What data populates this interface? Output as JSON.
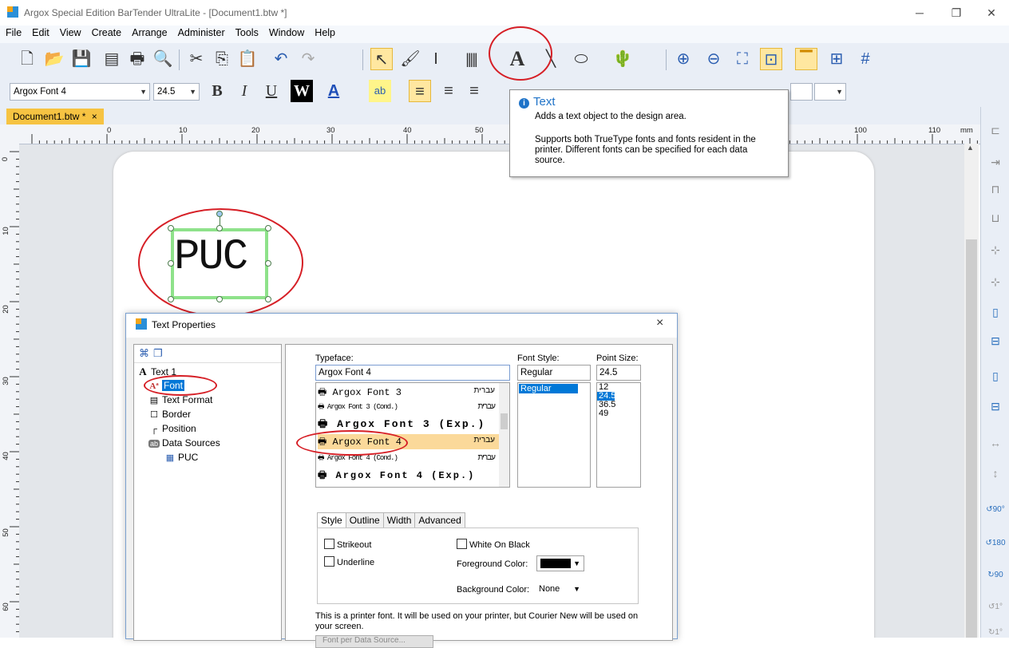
{
  "window": {
    "title": "Argox Special Edition BarTender UltraLite - [Document1.btw *]",
    "controls": {
      "minimize": "─",
      "restore": "❐",
      "close": "✕"
    }
  },
  "menubar": [
    "File",
    "Edit",
    "View",
    "Create",
    "Arrange",
    "Administer",
    "Tools",
    "Window",
    "Help"
  ],
  "format_toolbar": {
    "font_name": "Argox Font 4",
    "font_size": "24.5",
    "bold": "B",
    "italic": "I",
    "underline": "U",
    "white_on_black": "W",
    "font_color": "A",
    "highlight": "ab"
  },
  "document_tab": {
    "label": "Document1.btw *",
    "close": "×"
  },
  "ruler": {
    "unit": "mm",
    "h_marks": [
      "0",
      "10",
      "20",
      "30",
      "40",
      "50",
      "100",
      "110"
    ],
    "v_marks": [
      "0",
      "10",
      "20",
      "30",
      "40",
      "50",
      "60"
    ]
  },
  "label_object": {
    "text": "PUC"
  },
  "tooltip": {
    "title": "Text",
    "description": "Adds a text object to the design area.",
    "details": "Supports both TrueType fonts and fonts resident in the printer. Different fonts can be specified for each data source."
  },
  "dialog": {
    "title": "Text Properties",
    "close": "×",
    "tree": [
      {
        "label": "Text 1",
        "icon": "text-A-icon"
      },
      {
        "label": "Font",
        "icon": "font-icon",
        "selected": true
      },
      {
        "label": "Text Format",
        "icon": "text-format-icon"
      },
      {
        "label": "Border",
        "icon": "border-icon"
      },
      {
        "label": "Position",
        "icon": "position-icon"
      },
      {
        "label": "Data Sources",
        "icon": "data-sources-icon"
      },
      {
        "label": "PUC",
        "icon": "data-source-item-icon"
      }
    ],
    "font": {
      "typeface_label": "Typeface:",
      "typeface_value": "Argox Font 4",
      "style_label": "Font Style:",
      "style_value": "Regular",
      "size_label": "Point Size:",
      "size_value": "24.5",
      "typefaces": [
        {
          "name": "Argox Font 3",
          "script": "עברית"
        },
        {
          "name": "Argox Font 3 (Cond.)",
          "script": "עברית"
        },
        {
          "name": "Argox Font 3 (Exp.)",
          "script": ""
        },
        {
          "name": "Argox Font 4",
          "script": "עברית",
          "selected": true
        },
        {
          "name": "Argox Font 4 (Cond.)",
          "script": "עברית"
        },
        {
          "name": "Argox Font 4 (Exp.)",
          "script": ""
        }
      ],
      "styles": [
        "Regular"
      ],
      "sizes": [
        "12",
        "24.5",
        "36.5",
        "49"
      ],
      "selected_size": "24.5"
    },
    "tabs": [
      "Style",
      "Outline",
      "Width",
      "Advanced"
    ],
    "style_tab": {
      "strikeout": "Strikeout",
      "underline": "Underline",
      "white_on_black": "White On Black",
      "foreground_label": "Foreground Color:",
      "background_label": "Background Color:",
      "background_value": "None",
      "foreground_color": "#000000"
    },
    "note": "This is a printer font. It will be used on your printer, but Courier New will be used on your screen.",
    "font_per_source_button": "Font per Data Source..."
  }
}
